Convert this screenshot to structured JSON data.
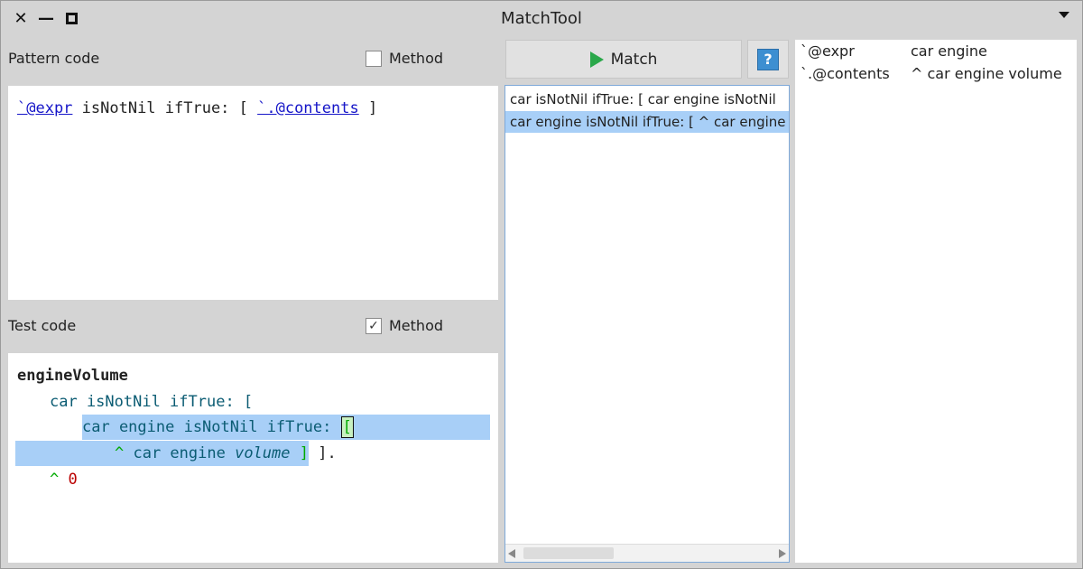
{
  "window": {
    "title": "MatchTool"
  },
  "pattern_section": {
    "label": "Pattern code",
    "method_label": "Method",
    "method_checked": false,
    "code": {
      "var1": "`@expr",
      "mid": " isNotNil ifTrue: [ ",
      "var2": "`.@contents",
      "end": " ]"
    }
  },
  "test_section": {
    "label": "Test code",
    "method_label": "Method",
    "method_checked": true,
    "code": {
      "line1": "engineVolume",
      "line2_a": "car isNotNil ifTrue: [",
      "line3_a": "car engine isNotNil ifTrue: ",
      "line3_b": "[",
      "line4_caret": "^",
      "line4_a": " car engine ",
      "line4_b": "volume",
      "line4_c": " ]",
      "line4_d": " ].",
      "line5_caret": "^",
      "line5_num": "0"
    }
  },
  "match_button": {
    "label": "Match"
  },
  "help_button": {
    "label": "?"
  },
  "matches": [
    {
      "text": "car isNotNil  ifTrue: [ car engine isNotNil",
      "selected": false
    },
    {
      "text": "car engine isNotNil  ifTrue: [ ^ car engine",
      "selected": true
    }
  ],
  "bindings": [
    {
      "key": "`@expr",
      "value": "car engine"
    },
    {
      "key": "`.@contents",
      "value": "^ car engine volume"
    }
  ]
}
